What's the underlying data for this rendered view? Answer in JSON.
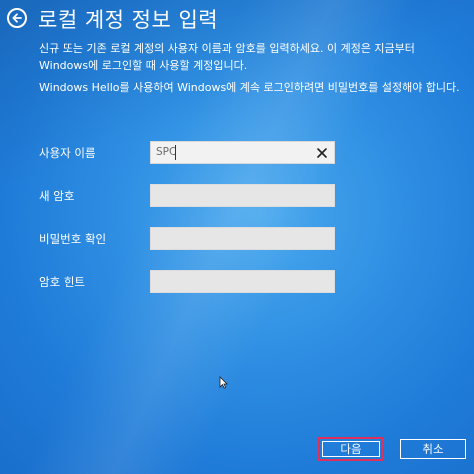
{
  "header": {
    "title": "로컬 계정 정보 입력"
  },
  "description": {
    "line1": "신규 또는 기존 로컬 계정의 사용자 이름과 암호를 입력하세요. 이 계정은 지금부터 Windows에 로그인할 때 사용할 계정입니다.",
    "line2": "Windows Hello를 사용하여 Windows에 계속 로그인하려면 비밀번호를 설정해야 합니다."
  },
  "form": {
    "username_label": "사용자 이름",
    "username_value": "SPC",
    "new_password_label": "새 암호",
    "confirm_password_label": "비밀번호 확인",
    "password_hint_label": "암호 힌트"
  },
  "buttons": {
    "next_label": "다음",
    "cancel_label": "취소"
  },
  "colors": {
    "focus_border": "#e0305a",
    "background": "#2f8fe3"
  }
}
